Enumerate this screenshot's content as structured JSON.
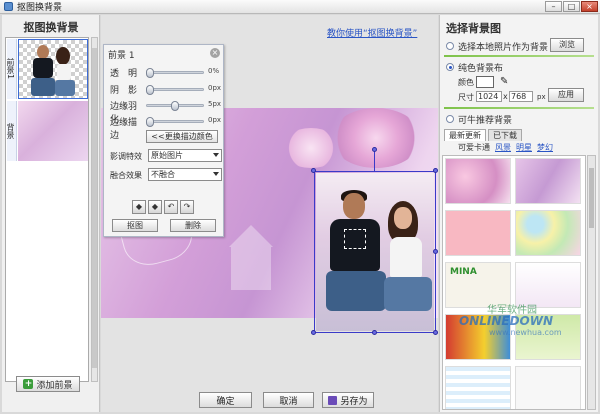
{
  "window": {
    "title": "抠图换背景",
    "buttons": {
      "minimize": "–",
      "maximize": "□",
      "close": "×"
    }
  },
  "left_panel": {
    "heading": "抠图换背景",
    "layers": [
      {
        "tag": "前景1"
      },
      {
        "tag": "背景"
      }
    ],
    "add_layer_label": "添加前景"
  },
  "center": {
    "help_link": "教你使用“抠图换背景”"
  },
  "foreground_dialog": {
    "title": "前景 1",
    "close_glyph": "×",
    "sliders": [
      {
        "label": "透　明",
        "value": "0%",
        "level": 0
      },
      {
        "label": "阴　影",
        "value": "0px",
        "level": 0
      },
      {
        "label": "边缘羽化",
        "value": "5px",
        "level": 0.45
      },
      {
        "label": "边缘描边",
        "value": "0px",
        "level": 0
      }
    ],
    "change_color_label": "<<更换描边颜色",
    "effect": {
      "label": "影调特效",
      "value": "原始图片"
    },
    "blend": {
      "label": "融合效果",
      "value": "不融合"
    },
    "tools": [
      "flip-horizontal",
      "flip-vertical",
      "rotate-left",
      "rotate-right"
    ],
    "tool_glyphs": [
      "◆",
      "◆",
      "↶",
      "↷"
    ],
    "cutout_label": "抠图",
    "delete_label": "删除"
  },
  "bottom_buttons": {
    "ok": "确定",
    "cancel": "取消",
    "save_as": "另存为"
  },
  "right_panel": {
    "heading": "选择背景图",
    "option_local": "选择本地照片作为背景",
    "browse_label": "浏览",
    "option_solid": "纯色背景布",
    "color_label": "颜色",
    "size_label": "尺寸",
    "width": "1024",
    "times": "x",
    "height": "768",
    "unit": "px",
    "apply_label": "应用",
    "option_recommend": "可牛推荐背景",
    "tabs": [
      "最新更新",
      "已下载"
    ],
    "categories": [
      "可爱卡通",
      "风景",
      "明星",
      "梦幻"
    ],
    "tile_text": "MINA",
    "watermark": {
      "line1": "华军软件园",
      "line2": "ONLINEDOWN",
      "line3": "www.newhua.com"
    },
    "colors": {
      "accent": "#2a55c5",
      "divider": "#7ec24a"
    }
  }
}
